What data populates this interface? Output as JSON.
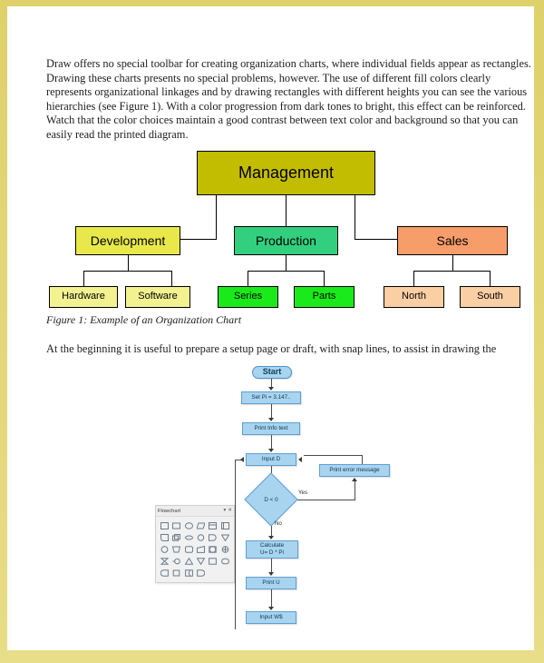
{
  "document": {
    "intro_paragraph": "Draw offers no special toolbar for creating organization charts, where individual fields appear as rectangles. Drawing these charts presents no special problems, however. The use of different fill colors clearly represents organizational linkages and by drawing rectangles with different heights you can see the various hierarchies (see Figure 1). With a color progression from dark tones to bright, this effect can be reinforced. Watch that the color choices maintain a good contrast between text color and background so that you can easily read the printed diagram.",
    "figure_caption": "Figure 1: Example of an Organization Chart",
    "setup_paragraph": "At the beginning it is useful to prepare a setup page or draft, with snap lines, to assist in drawing the",
    "watermark": "",
    "page_border_color": "#ddd069",
    "page_background": "#fdfdfb"
  },
  "chart_data": {
    "type": "diagram",
    "title": "Example of an Organization Chart",
    "diagram_kind": "organization-chart",
    "nodes": [
      {
        "id": "management",
        "label": "Management",
        "level": 0,
        "fill": "#c3bd00",
        "border": "#000000",
        "font_size": 18
      },
      {
        "id": "development",
        "label": "Development",
        "level": 1,
        "fill": "#e8e84a",
        "border": "#000000",
        "font_size": 14
      },
      {
        "id": "production",
        "label": "Production",
        "level": 1,
        "fill": "#32d07e",
        "border": "#000000",
        "font_size": 14
      },
      {
        "id": "sales",
        "label": "Sales",
        "level": 1,
        "fill": "#f79d6a",
        "border": "#000000",
        "font_size": 14
      },
      {
        "id": "hardware",
        "label": "Hardware",
        "level": 2,
        "fill": "#f2f291",
        "border": "#000000",
        "font_size": 11
      },
      {
        "id": "software",
        "label": "Software",
        "level": 2,
        "fill": "#f2f291",
        "border": "#000000",
        "font_size": 11
      },
      {
        "id": "series",
        "label": "Series",
        "level": 2,
        "fill": "#1aea1a",
        "border": "#000000",
        "font_size": 11
      },
      {
        "id": "parts",
        "label": "Parts",
        "level": 2,
        "fill": "#1aea1a",
        "border": "#000000",
        "font_size": 11
      },
      {
        "id": "north",
        "label": "North",
        "level": 2,
        "fill": "#fbcfa4",
        "border": "#000000",
        "font_size": 11
      },
      {
        "id": "south",
        "label": "South",
        "level": 2,
        "fill": "#fbcfa4",
        "border": "#000000",
        "font_size": 11
      }
    ],
    "edges": [
      {
        "from": "management",
        "to": "development"
      },
      {
        "from": "management",
        "to": "production"
      },
      {
        "from": "management",
        "to": "sales"
      },
      {
        "from": "development",
        "to": "hardware"
      },
      {
        "from": "development",
        "to": "software"
      },
      {
        "from": "production",
        "to": "series"
      },
      {
        "from": "production",
        "to": "parts"
      },
      {
        "from": "sales",
        "to": "north"
      },
      {
        "from": "sales",
        "to": "south"
      }
    ]
  },
  "flowchart": {
    "fill": "#a8d4f0",
    "stroke": "#5f9fd0",
    "nodes": [
      {
        "id": "start",
        "label": "Start",
        "shape": "terminator"
      },
      {
        "id": "setpi",
        "label": "Set Pi = 3.147..",
        "shape": "process"
      },
      {
        "id": "printinfo",
        "label": "Print Info text",
        "shape": "process"
      },
      {
        "id": "inputd",
        "label": "Input D",
        "shape": "process"
      },
      {
        "id": "dtest",
        "label": "D < 0",
        "shape": "decision"
      },
      {
        "id": "error",
        "label": "Print error message",
        "shape": "process"
      },
      {
        "id": "calc",
        "label": "Calculate\nU= D * Pi",
        "shape": "process"
      },
      {
        "id": "printu",
        "label": "Print U",
        "shape": "process"
      },
      {
        "id": "inputws",
        "label": "Input W$",
        "shape": "process"
      }
    ],
    "calc_line1": "Calculate",
    "calc_line2": "U= D * Pi",
    "edge_labels": {
      "yes": "Yes",
      "no": "No"
    }
  },
  "panel": {
    "title": "Flowchart",
    "dropdown_glyph": "▾",
    "close_glyph": "✕",
    "shapes": [
      "rectangle",
      "rectangle-alt",
      "ellipse",
      "parallelogram",
      "document",
      "card",
      "flag",
      "multi-document",
      "stored-data",
      "circle",
      "delay",
      "triangle-down",
      "circle-2",
      "trapezoid",
      "rounded-rectangle",
      "manual-input",
      "sequential-access",
      "collate",
      "hourglass",
      "connector-left",
      "triangle-up",
      "triangle-down-2",
      "square-io",
      "terminator",
      "rounded-left",
      "square-small",
      "storage",
      "rounded-right"
    ]
  }
}
